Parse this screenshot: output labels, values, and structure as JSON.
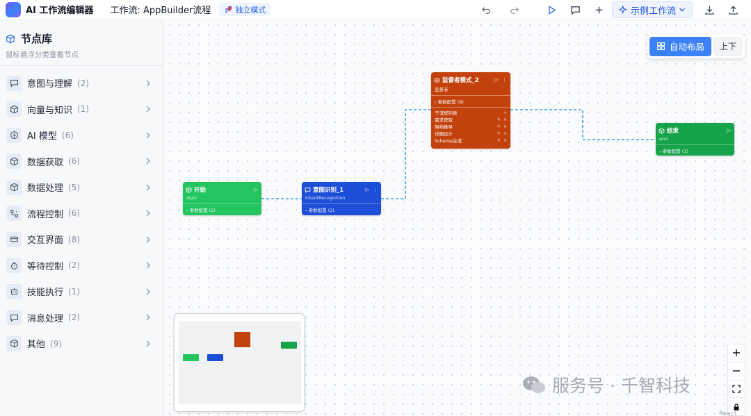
{
  "header": {
    "app_title": "AI 工作流编辑器",
    "workflow_label": "工作流: AppBuilder流程",
    "mode_badge": "独立模式",
    "example_button": "示例工作流"
  },
  "sidebar": {
    "title": "节点库",
    "subtitle": "鼠标悬浮分类查看节点",
    "categories": [
      {
        "label": "意图与理解",
        "count": "(2)",
        "icon": "chat-icon"
      },
      {
        "label": "向量与知识",
        "count": "(1)",
        "icon": "cube-icon"
      },
      {
        "label": "AI 模型",
        "count": "(6)",
        "icon": "ai-icon"
      },
      {
        "label": "数据获取",
        "count": "(6)",
        "icon": "cube-icon"
      },
      {
        "label": "数据处理",
        "count": "(5)",
        "icon": "cube-icon"
      },
      {
        "label": "流程控制",
        "count": "(6)",
        "icon": "flow-icon"
      },
      {
        "label": "交互界面",
        "count": "(8)",
        "icon": "card-icon"
      },
      {
        "label": "等待控制",
        "count": "(2)",
        "icon": "timer-icon"
      },
      {
        "label": "技能执行",
        "count": "(1)",
        "icon": "robot-icon"
      },
      {
        "label": "消息处理",
        "count": "(2)",
        "icon": "chat-icon"
      },
      {
        "label": "其他",
        "count": "(9)",
        "icon": "cube-icon"
      }
    ]
  },
  "canvas": {
    "auto_layout_label": "自动布局",
    "direction_label": "上下",
    "nodes": {
      "start": {
        "title": "开始",
        "type": "start",
        "params": "参数配置 (2)",
        "color": "#22c55e"
      },
      "intent": {
        "title": "意图识别_1",
        "type": "intentRecognition",
        "params": "参数配置 (2)",
        "color": "#1d4ed8"
      },
      "monitor": {
        "title": "监督者模式_2",
        "type": "监督者",
        "params": "参数配置 (8)",
        "section": "子流程列表",
        "rows": [
          "需求获取",
          "架构推导",
          "详细设计",
          "Schema生成"
        ],
        "color": "#c2410c"
      },
      "end": {
        "title": "结束",
        "type": "end",
        "params": "参数配置 (1)",
        "color": "#16a34a"
      }
    },
    "edge_color": "#3b9ee8",
    "watermark": "服务号 · 千智科技",
    "attribution": "React Flow"
  }
}
